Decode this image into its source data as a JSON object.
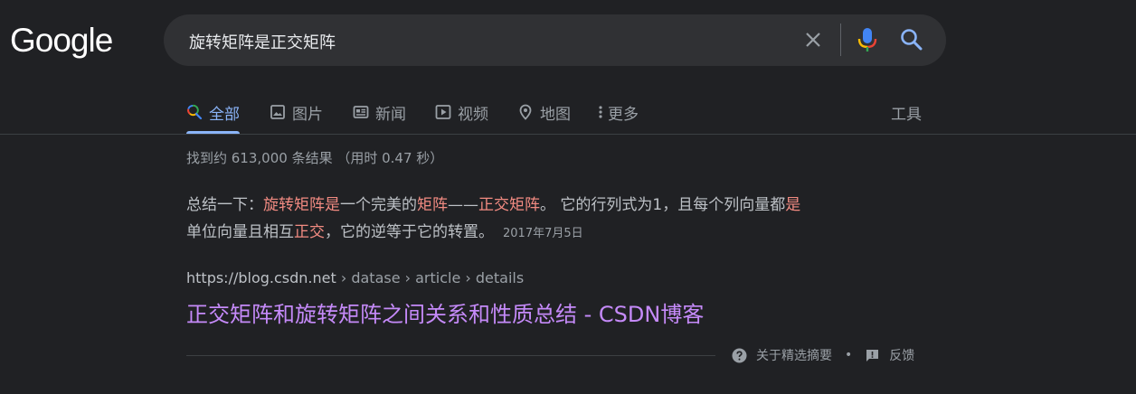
{
  "logo": "Google",
  "search": {
    "query": "旋转矩阵是正交矩阵"
  },
  "tabs": [
    {
      "label": "全部",
      "icon": "search-icon"
    },
    {
      "label": "图片",
      "icon": "image-icon"
    },
    {
      "label": "新闻",
      "icon": "news-icon"
    },
    {
      "label": "视频",
      "icon": "play-icon"
    },
    {
      "label": "地图",
      "icon": "map-pin-icon"
    },
    {
      "label": "更多",
      "icon": "more-vert-icon"
    }
  ],
  "tools_label": "工具",
  "stats": "找到约 613,000 条结果 （用时 0.47 秒）",
  "snippet": {
    "p1": "总结一下：",
    "h1": "旋转矩阵是",
    "p2": "一个完美的",
    "h2": "矩阵",
    "p3": "——",
    "h3": "正交矩阵",
    "p4": "。 它的行列式为1，且每个列向量都",
    "h4": "是",
    "p5": "单位向量且相互",
    "h5": "正交",
    "p6": "，它的逆等于它的转置。",
    "date": "2017年7月5日"
  },
  "result": {
    "domain": "https://blog.csdn.net",
    "path": " › datase › article › details",
    "title": "正交矩阵和旋转矩阵之间关系和性质总结 - CSDN博客"
  },
  "footer": {
    "about": "关于精选摘要",
    "bullet": "•",
    "feedback": "反馈"
  },
  "colors": {
    "accent": "#8ab4f8",
    "highlight": "#f28b82",
    "visited_link": "#c58af9"
  }
}
